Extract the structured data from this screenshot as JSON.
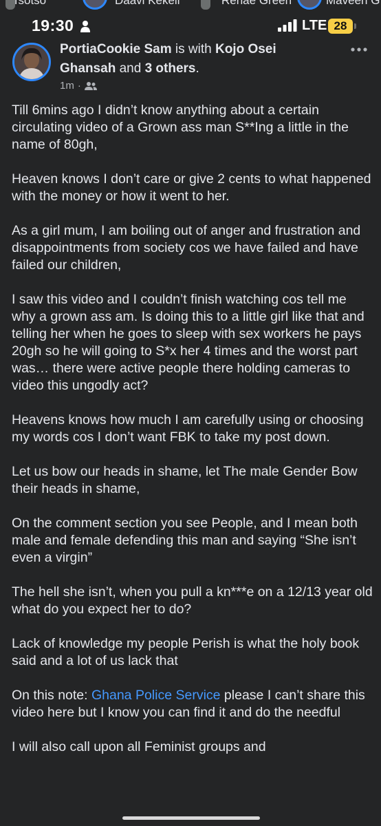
{
  "stories": {
    "names": [
      "Tsotso",
      "Daavi Kekeli",
      "Renae Green",
      "Maveen G"
    ]
  },
  "status_bar": {
    "time": "19:30",
    "network": "LTE",
    "battery": "28"
  },
  "post": {
    "author": "PortiaCookie Sam",
    "is_with": "is with",
    "tagged": "Kojo Osei Ghansah",
    "and": "and",
    "others": "3 others",
    "period": ".",
    "time_ago": "1m",
    "dot": "·",
    "paragraphs": [
      "Till 6mins ago I didn’t know anything about a certain circulating video of a Grown ass man S**Ing a little in the name of 80gh,",
      "Heaven knows I don’t care or give 2 cents to what happened with the money or how it went to her.",
      "As a girl mum, I am boiling out of anger and frustration and disappointments from society cos we have failed and have failed our children,",
      "I saw this video and I couldn’t finish watching cos tell me why a grown ass am. Is doing this to a little girl like that and telling her when he goes to sleep with sex workers he pays 20gh so he will going to S*x her 4 times and the worst part was… there were active people there holding cameras to video this ungodly act?",
      "Heavens knows how much I am carefully using or choosing my words cos I don’t want FBK to take my post down.",
      "Let us bow our heads in shame, let The male Gender Bow their heads in shame,",
      "On the comment section you see People, and I mean both male and female defending this man and saying “She isn’t even a virgin”",
      "The hell she isn’t, when you pull a kn***e on a 12/13 year old what do you expect her to do?",
      "Lack of knowledge my people Perish is what the holy book said and a lot of us lack that"
    ],
    "note_prefix": "On this note: ",
    "note_link": "Ghana Police Service",
    "note_suffix": " please I can’t share this video here but I know you can find it and do the needful",
    "last_line": "I will also call upon all Feminist groups and"
  },
  "colors": {
    "background": "#242526",
    "text": "#e4e6eb",
    "link": "#4599ff",
    "accent_ring": "#2d88ff",
    "battery": "#f7ce46"
  },
  "icons": [
    "person-icon",
    "signal-icon",
    "friends-icon",
    "more-options-icon"
  ]
}
